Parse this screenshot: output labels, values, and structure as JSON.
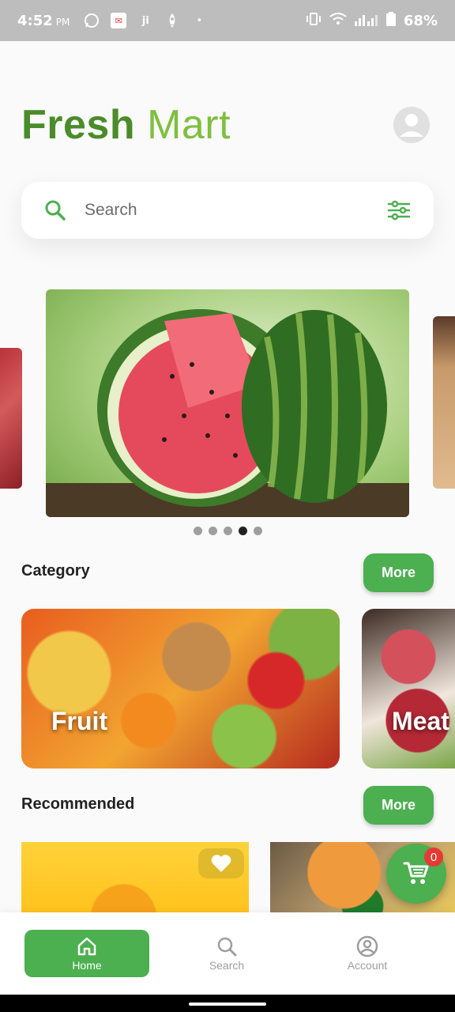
{
  "status_bar": {
    "time": "4:52",
    "ampm": "PM",
    "battery": "68%",
    "icons": [
      "whatsapp-icon",
      "notification-app-icon",
      "jiji-icon",
      "rocket-icon",
      "dot-icon",
      "vibrate-icon",
      "wifi-icon",
      "signal-icon",
      "battery-icon"
    ]
  },
  "header": {
    "title_part1": "Fresh",
    "title_part2": "Mart"
  },
  "search": {
    "placeholder": "Search"
  },
  "carousel": {
    "slide_count": 5,
    "active_index": 3
  },
  "category": {
    "title": "Category",
    "more_label": "More",
    "items": [
      {
        "label": "Fruit"
      },
      {
        "label": "Meat"
      }
    ]
  },
  "recommended": {
    "title": "Recommended",
    "more_label": "More"
  },
  "cart": {
    "count": "0"
  },
  "bottom_nav": {
    "items": [
      {
        "label": "Home"
      },
      {
        "label": "Search"
      },
      {
        "label": "Account"
      }
    ]
  },
  "colors": {
    "accent": "#4caf50",
    "badge": "#e53935",
    "status_bar": "#bdbdbd"
  }
}
